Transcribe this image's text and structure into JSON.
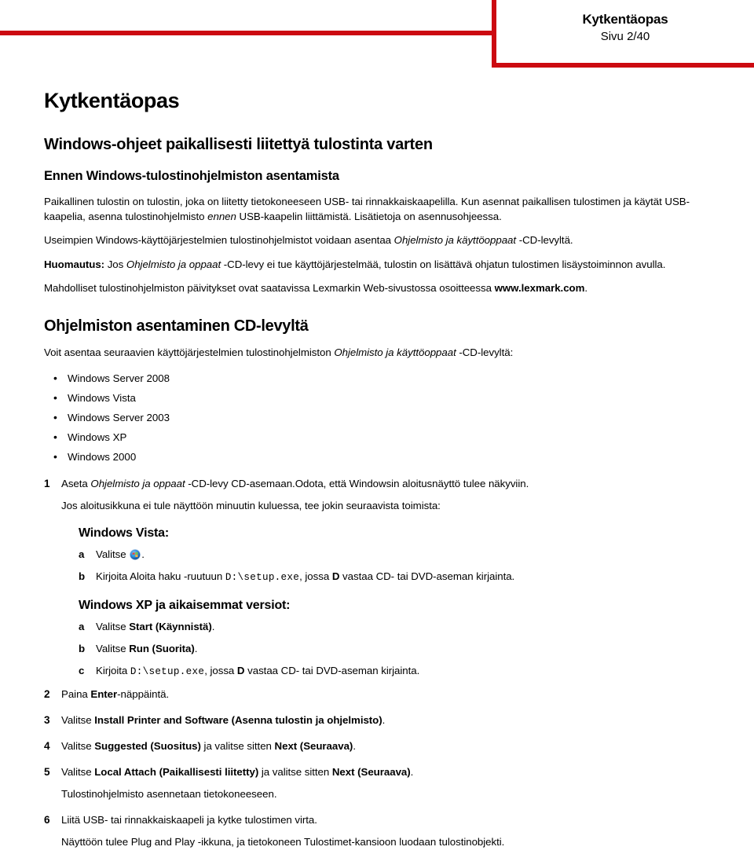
{
  "brand_color": "#CC0A11",
  "header": {
    "title": "Kytkentäopas",
    "page_label": "Sivu 2/40"
  },
  "document": {
    "title": "Kytkentäopas",
    "section_heading": "Windows-ohjeet paikallisesti liitettyä tulostinta varten",
    "subsection_heading": "Ennen Windows-tulostinohjelmiston asentamista",
    "paragraphs": {
      "p1_a": "Paikallinen tulostin on tulostin, joka on liitetty tietokoneeseen USB- tai rinnakkaiskaapelilla. Kun asennat paikallisen tulostimen ja käytät USB-kaapelia, asenna tulostinohjelmisto ",
      "p1_em": "ennen",
      "p1_b": " USB-kaapelin liittämistä. Lisätietoja on asennusohjeessa.",
      "p2_a": "Useimpien Windows-käyttöjärjestelmien tulostinohjelmistot voidaan asentaa ",
      "p2_em": "Ohjelmisto ja käyttöoppaat",
      "p2_b": " -CD-levyltä.",
      "p3_label": "Huomautus:",
      "p3_a": " Jos ",
      "p3_em": "Ohjelmisto ja oppaat",
      "p3_b": " -CD-levy ei tue käyttöjärjestelmää, tulostin on lisättävä ohjatun tulostimen lisäystoiminnon avulla.",
      "p4_a": "Mahdolliset tulostinohjelmiston päivitykset ovat saatavissa Lexmarkin Web-sivustossa osoitteessa ",
      "p4_url": "www.lexmark.com",
      "p4_b": "."
    },
    "install_section": {
      "heading": "Ohjelmiston asentaminen CD-levyltä",
      "intro_a": "Voit asentaa seuraavien käyttöjärjestelmien tulostinohjelmiston ",
      "intro_em": "Ohjelmisto ja käyttöoppaat",
      "intro_b": " -CD-levyltä:",
      "os_list": [
        "Windows Server 2008",
        "Windows Vista",
        "Windows Server 2003",
        "Windows XP",
        "Windows 2000"
      ]
    },
    "steps": [
      {
        "num": "1",
        "text_a": "Aseta ",
        "text_em": "Ohjelmisto ja oppaat",
        "text_b": " -CD-levy CD-asemaan.Odota, että Windowsin aloitusnäyttö tulee näkyviin.",
        "note": "Jos aloitusikkuna ei tule näyttöön minuutin kuluessa, tee jokin seuraavista toimista:"
      },
      {
        "num": "2",
        "text_a": "Paina ",
        "bold": "Enter",
        "text_b": "-näppäintä."
      },
      {
        "num": "3",
        "text_a": "Valitse ",
        "bold": "Install Printer and Software (Asenna tulostin ja ohjelmisto)",
        "text_b": "."
      },
      {
        "num": "4",
        "text_a": "Valitse ",
        "bold": "Suggested (Suositus)",
        "text_mid": " ja valitse sitten ",
        "bold2": "Next (Seuraava)",
        "text_b": "."
      },
      {
        "num": "5",
        "text_a": "Valitse ",
        "bold": "Local Attach (Paikallisesti liitetty)",
        "text_mid": " ja valitse sitten ",
        "bold2": "Next (Seuraava)",
        "text_b": ".",
        "note": "Tulostinohjelmisto asennetaan tietokoneeseen."
      },
      {
        "num": "6",
        "text_a": "Liitä USB- tai rinnakkaiskaapeli ja kytke tulostimen virta.",
        "note": "Näyttöön tulee Plug and Play -ikkuna, ja tietokoneen Tulostimet-kansioon luodaan tulostinobjekti."
      }
    ],
    "vista_block": {
      "heading": "Windows Vista:",
      "a_letter": "a",
      "a_text_before": "Valitse ",
      "a_icon": "windows-vista-start-orb-icon",
      "a_text_after": ".",
      "b_letter": "b",
      "b_text_a": "Kirjoita Aloita haku -ruutuun ",
      "b_mono": "D:\\setup.exe",
      "b_text_mid": ", jossa ",
      "b_bold": "D",
      "b_text_b": " vastaa CD- tai DVD-aseman kirjainta."
    },
    "xp_block": {
      "heading": "Windows XP ja aikaisemmat versiot:",
      "a_letter": "a",
      "a_text": "Valitse ",
      "a_bold": "Start (Käynnistä)",
      "a_text_end": ".",
      "b_letter": "b",
      "b_text": "Valitse ",
      "b_bold": "Run (Suorita)",
      "b_text_end": ".",
      "c_letter": "c",
      "c_text_a": "Kirjoita ",
      "c_mono": "D:\\setup.exe",
      "c_text_mid": ", jossa ",
      "c_bold": "D",
      "c_text_b": " vastaa CD- tai DVD-aseman kirjainta."
    }
  }
}
